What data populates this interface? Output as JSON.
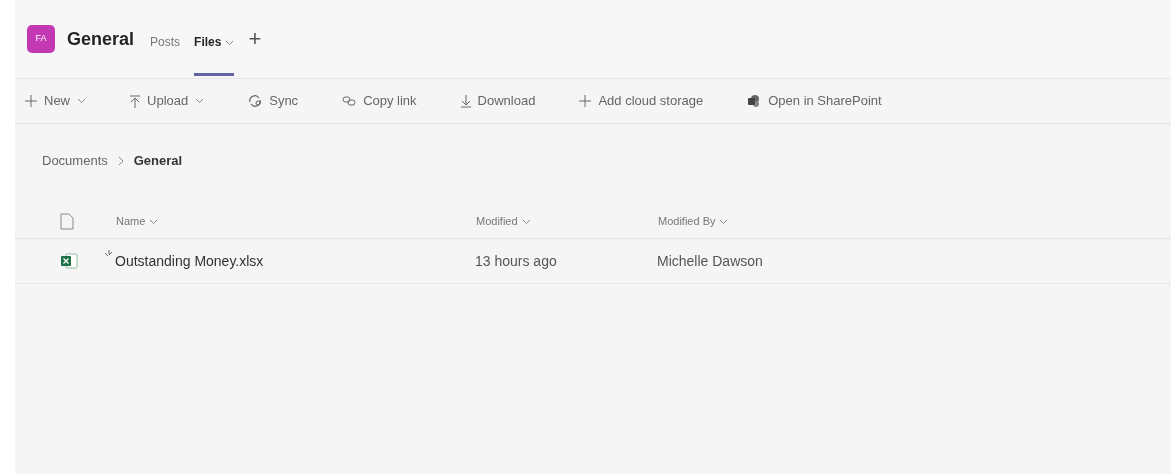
{
  "team": {
    "avatar": "FA",
    "color": "#c239b3"
  },
  "channel": {
    "title": "General"
  },
  "tabs": [
    {
      "label": "Posts",
      "selected": false,
      "dropdown": false
    },
    {
      "label": "Files",
      "selected": true,
      "dropdown": true
    }
  ],
  "add_tab": "+",
  "toolbar": [
    {
      "kind": "new",
      "label": "New",
      "dropdown": true
    },
    {
      "kind": "upload",
      "label": "Upload",
      "dropdown": true
    },
    {
      "kind": "sync",
      "label": "Sync",
      "dropdown": false
    },
    {
      "kind": "link",
      "label": "Copy link",
      "dropdown": false
    },
    {
      "kind": "download",
      "label": "Download",
      "dropdown": false
    },
    {
      "kind": "add",
      "label": "Add cloud storage",
      "dropdown": false
    },
    {
      "kind": "sharepoint",
      "label": "Open in SharePoint",
      "dropdown": false
    }
  ],
  "breadcrumb": [
    {
      "label": "Documents",
      "current": false
    },
    {
      "label": "General",
      "current": true
    }
  ],
  "table": {
    "columns": [
      "Name",
      "Modified",
      "Modified By"
    ],
    "rows": [
      {
        "name": "Outstanding Money.xlsx",
        "new": true,
        "modified": "13 hours ago",
        "modified_by": "Michelle Dawson"
      }
    ]
  }
}
